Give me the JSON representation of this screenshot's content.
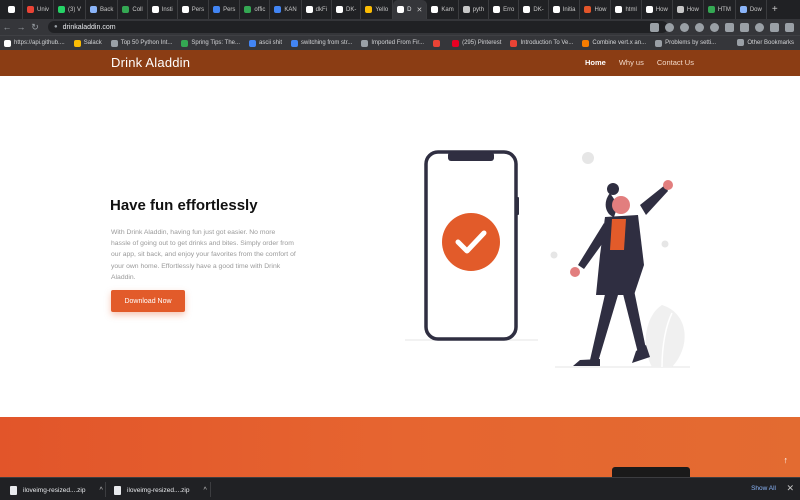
{
  "browser": {
    "tabs": [
      {
        "label": "",
        "color": "#ffffff"
      },
      {
        "label": "Univ",
        "color": "#ea4335"
      },
      {
        "label": "(3) V",
        "color": "#25d366"
      },
      {
        "label": "Back",
        "color": "#8ab4f8"
      },
      {
        "label": "Coll",
        "color": "#34a853"
      },
      {
        "label": "Insti",
        "color": "#ffffff"
      },
      {
        "label": "Pers",
        "color": "#ffffff"
      },
      {
        "label": "Pers",
        "color": "#4285f4"
      },
      {
        "label": "offic",
        "color": "#34a853"
      },
      {
        "label": "KAN",
        "color": "#4285f4"
      },
      {
        "label": "dkFi",
        "color": "#ffffff"
      },
      {
        "label": "DK-",
        "color": "#ffffff"
      },
      {
        "label": "Yello",
        "color": "#fbbc04"
      },
      {
        "label": "D",
        "color": "#ffffff",
        "active": true
      },
      {
        "label": "Kam",
        "color": "#ffffff"
      },
      {
        "label": "pyth",
        "color": "#c7c7c7"
      },
      {
        "label": "Erro",
        "color": "#ffffff"
      },
      {
        "label": "DK-",
        "color": "#ffffff"
      },
      {
        "label": "Initia",
        "color": "#ffffff"
      },
      {
        "label": "How",
        "color": "#e2552a"
      },
      {
        "label": "html",
        "color": "#ffffff"
      },
      {
        "label": "How",
        "color": "#ffffff"
      },
      {
        "label": "How",
        "color": "#c7c7c7"
      },
      {
        "label": "HTM",
        "color": "#34a853"
      },
      {
        "label": "Dow",
        "color": "#8ab4f8"
      }
    ],
    "url": "drinkaladdin.com",
    "bookmarks": [
      {
        "label": "https://api.github....",
        "color": "#ffffff"
      },
      {
        "label": "Salack",
        "color": "#fbbc04"
      },
      {
        "label": "Top 50 Python Int...",
        "color": "#9aa0a6"
      },
      {
        "label": "Spring Tips: The...",
        "color": "#34a853"
      },
      {
        "label": "ascii shit",
        "color": "#4285f4"
      },
      {
        "label": "switching from str...",
        "color": "#4285f4"
      },
      {
        "label": "Imported From Fir...",
        "color": "#9aa0a6"
      },
      {
        "label": "",
        "color": "#ea4335"
      },
      {
        "label": "(295) Pinterest",
        "color": "#e60023"
      },
      {
        "label": "Introduction To Ve...",
        "color": "#ea4335"
      },
      {
        "label": "Combine vert.x an...",
        "color": "#f57c00"
      },
      {
        "label": "Problems by setti...",
        "color": "#9aa0a6"
      }
    ],
    "other_bookmarks": "Other Bookmarks"
  },
  "site": {
    "brand": "Drink Aladdin",
    "nav": [
      {
        "label": "Home",
        "current": true
      },
      {
        "label": "Why us",
        "current": false
      },
      {
        "label": "Contact Us",
        "current": false
      }
    ]
  },
  "hero": {
    "title": "Have fun effortlessly",
    "text": "With Drink Aladdin, having fun just got easier. No more hassle of going out to get drinks and bites. Simply order from our app, sit back, and enjoy your favorites from the comfort of your own home. Effortlessly have a good time with Drink Aladdin.",
    "cta": "Download Now"
  },
  "colors": {
    "brand_header": "#8b3d14",
    "accent": "#e25b2a",
    "figure_dark": "#2f2e41"
  },
  "downloads": {
    "items": [
      "iloveimg-resized....zip",
      "iloveimg-resized....zip"
    ],
    "show_all": "Show All"
  }
}
